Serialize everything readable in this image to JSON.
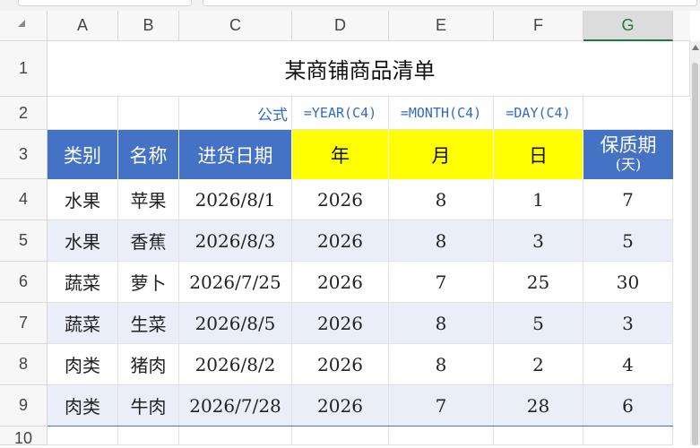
{
  "columns": [
    "A",
    "B",
    "C",
    "D",
    "E",
    "F",
    "G"
  ],
  "rows": [
    "1",
    "2",
    "3",
    "4",
    "5",
    "6",
    "7",
    "8",
    "9",
    "10"
  ],
  "title": "某商铺商品清单",
  "formula_label": "公式",
  "formulas": [
    "=YEAR(C4)",
    "=MONTH(C4)",
    "=DAY(C4)"
  ],
  "headers": {
    "category": "类别",
    "name": "名称",
    "date": "进货日期",
    "year": "年",
    "month": "月",
    "day": "日",
    "shelf": "保质期",
    "shelf_unit": "(天)"
  },
  "data": [
    [
      "水果",
      "苹果",
      "2026/8/1",
      "2026",
      "8",
      "1",
      "7"
    ],
    [
      "水果",
      "香蕉",
      "2026/8/3",
      "2026",
      "8",
      "3",
      "5"
    ],
    [
      "蔬菜",
      "萝卜",
      "2026/7/25",
      "2026",
      "7",
      "25",
      "30"
    ],
    [
      "蔬菜",
      "生菜",
      "2026/8/5",
      "2026",
      "8",
      "5",
      "3"
    ],
    [
      "肉类",
      "猪肉",
      "2026/8/2",
      "2026",
      "8",
      "2",
      "4"
    ],
    [
      "肉类",
      "牛肉",
      "2026/7/28",
      "2026",
      "7",
      "28",
      "6"
    ]
  ],
  "colors": {
    "header_blue": "#4472c4",
    "header_yellow": "#ffff00",
    "band": "#e9eef8",
    "formula_text": "#2f6bc4"
  }
}
